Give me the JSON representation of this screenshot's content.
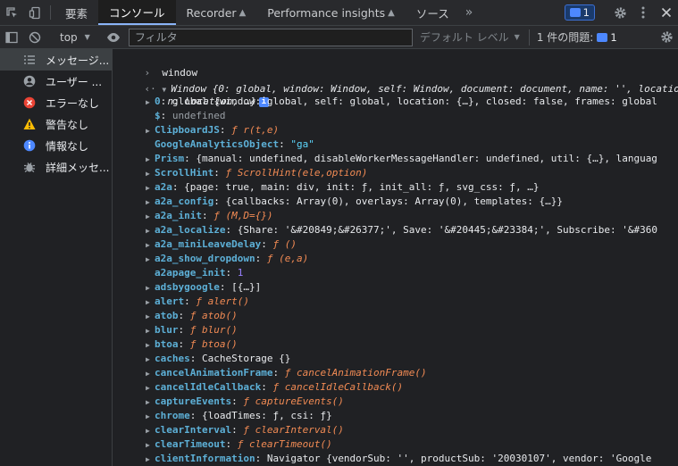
{
  "tabbar": {
    "tabs": [
      {
        "label": "要素"
      },
      {
        "label": "コンソール"
      },
      {
        "label": "Recorder"
      },
      {
        "label": "Performance insights"
      },
      {
        "label": "ソース"
      }
    ],
    "issue_badge_count": "1"
  },
  "toolbar": {
    "context": "top",
    "filter_placeholder": "フィルタ",
    "levels_label": "デフォルト レベル",
    "issues_label": "1 件の問題:",
    "issues_count": "1"
  },
  "sidebar": {
    "items": [
      {
        "label": "メッセージ..."
      },
      {
        "label": "ユーザー ..."
      },
      {
        "label": "エラーなし"
      },
      {
        "label": "警告なし"
      },
      {
        "label": "情報なし"
      },
      {
        "label": "詳細メッセ..."
      }
    ]
  },
  "console": {
    "input": "window",
    "summary_line1": "Window {0: global, window: Window, self: Window, document: document, name: '', locatio",
    "summary_line2": "n: Location, …}",
    "props": [
      {
        "key": "0",
        "val": "global {window: global, self: global, location: {…}, closed: false, frames: global"
      },
      {
        "key": "$",
        "val": "undefined"
      },
      {
        "key": "ClipboardJS",
        "val": "ƒ r(t,e)"
      },
      {
        "key": "GoogleAnalyticsObject",
        "val": "\"ga\""
      },
      {
        "key": "Prism",
        "val": "{manual: undefined, disableWorkerMessageHandler: undefined, util: {…}, languag"
      },
      {
        "key": "ScrollHint",
        "val": "ƒ ScrollHint(ele,option)"
      },
      {
        "key": "a2a",
        "val": "{page: true, main: div, init: ƒ, init_all: ƒ, svg_css: ƒ, …}"
      },
      {
        "key": "a2a_config",
        "val": "{callbacks: Array(0), overlays: Array(0), templates: {…}}"
      },
      {
        "key": "a2a_init",
        "val": "ƒ (M,D={})"
      },
      {
        "key": "a2a_localize",
        "val": "{Share: '&#20849;&#26377;', Save: '&#20445;&#23384;', Subscribe: '&#360"
      },
      {
        "key": "a2a_miniLeaveDelay",
        "val": "ƒ ()"
      },
      {
        "key": "a2a_show_dropdown",
        "val": "ƒ (e,a)"
      },
      {
        "key": "a2apage_init",
        "val": "1"
      },
      {
        "key": "adsbygoogle",
        "val": "[{…}]"
      },
      {
        "key": "alert",
        "val": "ƒ alert()"
      },
      {
        "key": "atob",
        "val": "ƒ atob()"
      },
      {
        "key": "blur",
        "val": "ƒ blur()"
      },
      {
        "key": "btoa",
        "val": "ƒ btoa()"
      },
      {
        "key": "caches",
        "val": "CacheStorage {}"
      },
      {
        "key": "cancelAnimationFrame",
        "val": "ƒ cancelAnimationFrame()"
      },
      {
        "key": "cancelIdleCallback",
        "val": "ƒ cancelIdleCallback()"
      },
      {
        "key": "captureEvents",
        "val": "ƒ captureEvents()"
      },
      {
        "key": "chrome",
        "val": "{loadTimes: ƒ, csi: ƒ}"
      },
      {
        "key": "clearInterval",
        "val": "ƒ clearInterval()"
      },
      {
        "key": "clearTimeout",
        "val": "ƒ clearTimeout()"
      },
      {
        "key": "clientInformation",
        "val": "Navigator {vendorSub: '', productSub: '20030107', vendor: 'Google"
      }
    ]
  },
  "colors": {
    "accent": "#8ab4f8",
    "key": "#5db0d7",
    "function": "#f28b54",
    "string": "#5cd5fb",
    "keyword": "#9980ff",
    "error": "#ea4335",
    "warning": "#fbbc04",
    "info": "#4d88ff"
  }
}
